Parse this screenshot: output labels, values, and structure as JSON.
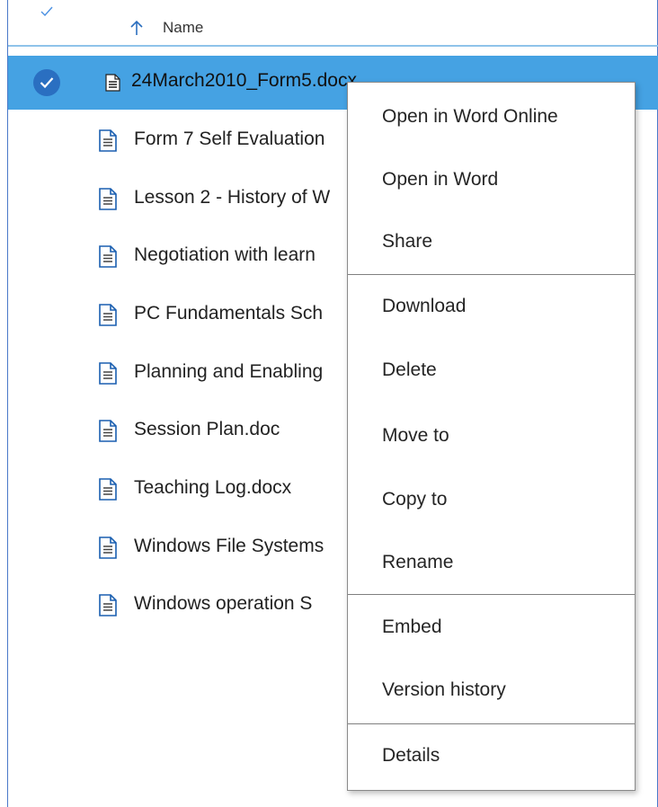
{
  "header": {
    "column_label": "Name",
    "sort_icon": "arrow-up-icon",
    "select_all_icon": "check-icon"
  },
  "files": [
    {
      "name": "24March2010_Form5.docx",
      "selected": true
    },
    {
      "name": "Form 7 Self Evaluation",
      "selected": false
    },
    {
      "name": "Lesson 2 - History of W",
      "selected": false
    },
    {
      "name": "Negotiation with learn",
      "selected": false
    },
    {
      "name": "PC Fundamentals Sch",
      "selected": false
    },
    {
      "name": "Planning and Enabling",
      "selected": false
    },
    {
      "name": "Session Plan.doc",
      "selected": false
    },
    {
      "name": "Teaching Log.docx",
      "selected": false
    },
    {
      "name": "Windows File Systems",
      "selected": false
    },
    {
      "name": "Windows operation S",
      "selected": false
    }
  ],
  "context_menu": {
    "items": [
      "Open in Word Online",
      "Open in Word",
      "Share",
      "Download",
      "Delete",
      "Move to",
      "Copy to",
      "Rename",
      "Embed",
      "Version history",
      "Details"
    ]
  },
  "colors": {
    "selected_row": "#45a2e3",
    "selection_circle": "#2a6fc1",
    "accent": "#4a79c9",
    "icon": "#1a5fb0"
  }
}
